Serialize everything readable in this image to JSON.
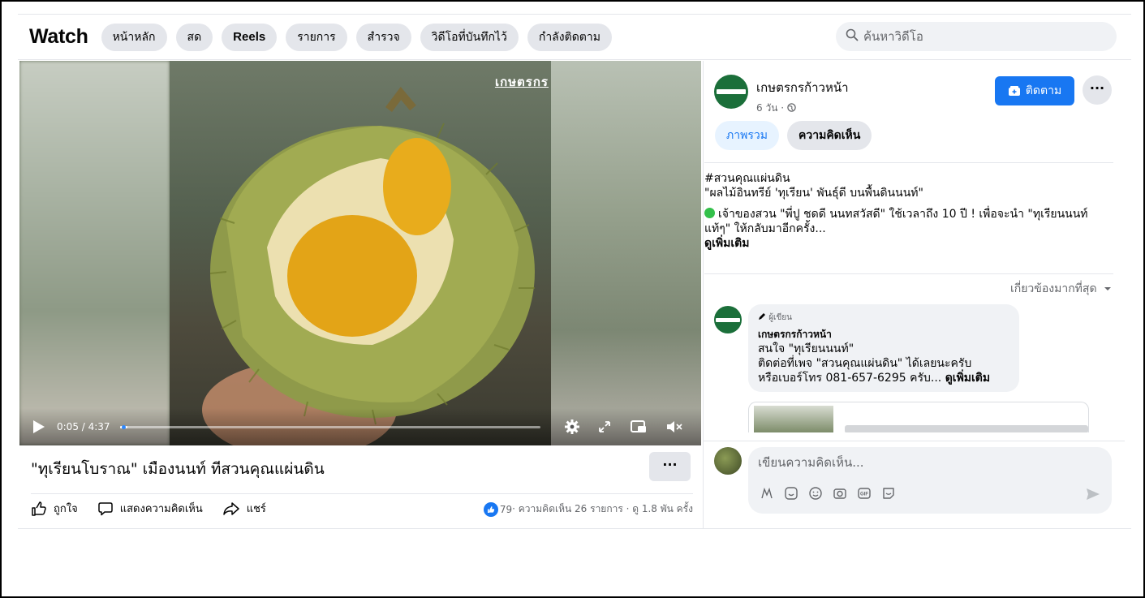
{
  "header": {
    "title": "Watch",
    "nav": [
      "หน้าหลัก",
      "สด",
      "Reels",
      "รายการ",
      "สำรวจ",
      "วิดีโอที่บันทึกไว้",
      "กำลังติดตาม"
    ],
    "search_placeholder": "ค้นหาวิดีโอ"
  },
  "video": {
    "brand_mark": "เกษตรกร",
    "time": "0:05 / 4:37",
    "progress": 0.018,
    "title": "\"ทุเรียนโบราณ\" เมืองนนท์ ทีสวนคุณแผ่นดิน",
    "more_label": "···"
  },
  "actions": {
    "like": "ถูกใจ",
    "comment": "แสดงความคิดเห็น",
    "share": "แชร์",
    "likes_count": "79",
    "stats_text": " · ความคิดเห็น 26 รายการ · ดู 1.8 พัน ครั้ง"
  },
  "page": {
    "name": "เกษตรกรก้าวหน้า",
    "time": "6 วัน ·",
    "follow_label": "ติดตาม",
    "more_label": "···"
  },
  "tabs": [
    "ภาพรวม",
    "ความคิดเห็น"
  ],
  "description": {
    "hashtag": "#สวนคุณแผ่นดิน",
    "line1": "\"ผลไม้อินทรีย์ 'ทุเรียน' พันธุ์ดี บนพื้นดินนนท์\"",
    "line2": "เจ้าของสวน \"พี่ปู ชดดี นนทสวัสดี\" ใช้เวลาถึง 10 ปี ! เพื่อจะนำ \"ทุเรียนนนท์แท้ๆ\" ให้กลับมาอีกครั้ง...",
    "see_more": "ดูเพิ่มเติม"
  },
  "comments": {
    "sort_label": "เกี่ยวข้องมากที่สุด",
    "items": [
      {
        "badge": "ผู้เขียน",
        "author": "เกษตรกรก้าวหน้า",
        "line1": "สนใจ \"ทุเรียนนนท์\"",
        "line2": "ติดต่อที่เพจ \"สวนคุณแผ่นดิน\" ได้เลยนะครับ",
        "line3": "หรือเบอร์โทร 081-657-6295 ครับ...",
        "see_more": "ดูเพิ่มเติม"
      }
    ],
    "composer_placeholder": "เขียนความคิดเห็น..."
  },
  "colors": {
    "accent": "#1877f2",
    "page_green": "#1b6f3a",
    "pill_bg": "#e4e6eb",
    "green_dot": "#33c04a"
  }
}
